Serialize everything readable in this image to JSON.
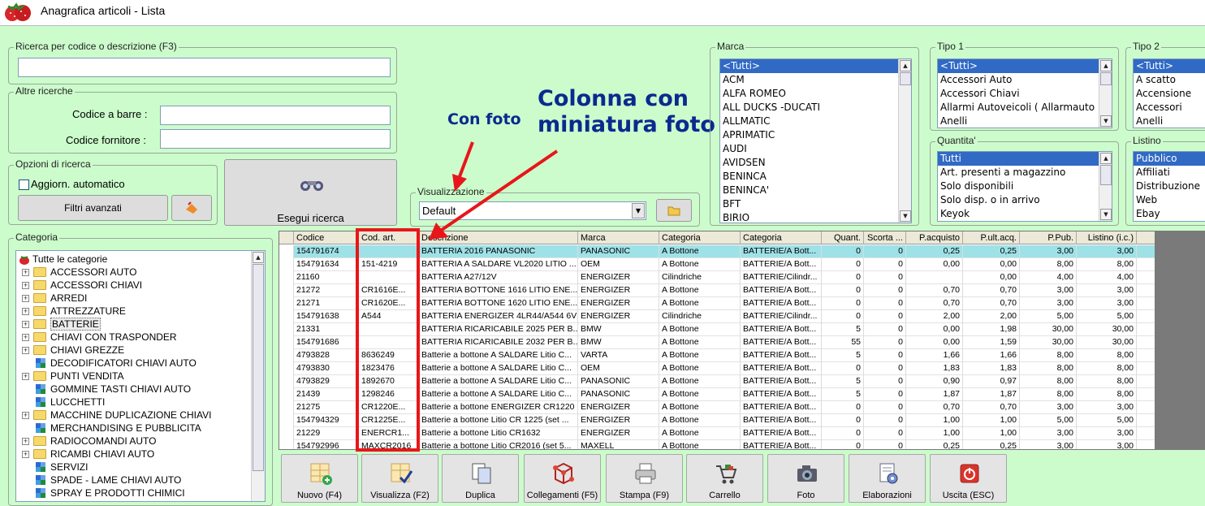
{
  "window": {
    "title": "Anagrafica articoli  - Lista"
  },
  "search": {
    "main_group": "Ricerca per codice o descrizione (F3)",
    "main_value": "",
    "other_group": "Altre ricerche",
    "barcode_label": "Codice a barre :",
    "supplier_label": "Codice fornitore :",
    "options_group": "Opzioni di ricerca",
    "auto_update_label": "Aggiorn. automatico",
    "advanced_filters": "Filtri avanzati",
    "run_search": "Esegui ricerca"
  },
  "view": {
    "group": "Visualizzazione",
    "selected": "Default"
  },
  "annotations": {
    "con_foto": "Con foto",
    "colonna_line1": "Colonna con",
    "colonna_line2": "miniatura foto",
    "color": "#e8161a",
    "text_color": "#0a2a8f"
  },
  "filters": {
    "marca": {
      "label": "Marca",
      "items": [
        "<Tutti>",
        "ACM",
        "ALFA ROMEO",
        "ALL DUCKS -DUCATI",
        "ALLMATIC",
        "APRIMATIC",
        "AUDI",
        "AVIDSEN",
        "BENINCA",
        "BENINCA'",
        "BFT",
        "BIRIO"
      ]
    },
    "tipo1": {
      "label": "Tipo 1",
      "items": [
        "<Tutti>",
        "Accessori Auto",
        "Accessori Chiavi",
        "Allarmi Autoveicoli ( Allarmauto )",
        "Anelli"
      ]
    },
    "tipo2": {
      "label": "Tipo 2",
      "items": [
        "<Tutti>",
        "A scatto",
        "Accensione",
        "Accessori",
        "Anelli"
      ]
    },
    "quantita": {
      "label": "Quantita'",
      "items": [
        "Tutti",
        "Art. presenti a magazzino",
        "Solo disponibili",
        "Solo disp. o in arrivo",
        "Keyok"
      ]
    },
    "listino": {
      "label": "Listino",
      "items": [
        "Pubblico",
        "Affiliati",
        "Distribuzione",
        "Web",
        "Ebay"
      ]
    }
  },
  "categories": {
    "label": "Categoria",
    "root": "Tutte le categorie",
    "items": [
      {
        "name": "ACCESSORI AUTO",
        "type": "folder"
      },
      {
        "name": "ACCESSORI CHIAVI",
        "type": "folder"
      },
      {
        "name": "ARREDI",
        "type": "folder"
      },
      {
        "name": "ATTREZZATURE",
        "type": "folder"
      },
      {
        "name": "BATTERIE",
        "type": "folder"
      },
      {
        "name": "CHIAVI CON TRASPONDER",
        "type": "folder"
      },
      {
        "name": "CHIAVI GREZZE",
        "type": "folder"
      },
      {
        "name": "DECODIFICATORI CHIAVI AUTO",
        "type": "leaf"
      },
      {
        "name": "PUNTI VENDITA",
        "type": "folder"
      },
      {
        "name": "GOMMINE TASTI CHIAVI AUTO",
        "type": "leaf"
      },
      {
        "name": "LUCCHETTI",
        "type": "leaf"
      },
      {
        "name": "MACCHINE DUPLICAZIONE CHIAVI",
        "type": "folder"
      },
      {
        "name": "MERCHANDISING E PUBBLICITA",
        "type": "leaf"
      },
      {
        "name": "RADIOCOMANDI AUTO",
        "type": "folder"
      },
      {
        "name": "RICAMBI CHIAVI AUTO",
        "type": "folder"
      },
      {
        "name": "SERVIZI",
        "type": "leaf"
      },
      {
        "name": "SPADE - LAME CHIAVI AUTO",
        "type": "leaf"
      },
      {
        "name": "SPRAY E PRODOTTI CHIMICI",
        "type": "leaf"
      }
    ]
  },
  "table": {
    "columns": [
      "Codice",
      "Cod. art.",
      "Descrizione",
      "Marca",
      "Categoria",
      "Categoria",
      "Quant.",
      "Scorta ...",
      "P.acquisto",
      "P.ult.acq.",
      "P.Pub.",
      "Listino (i.c.)"
    ],
    "rows": [
      [
        "154791674",
        "",
        "BATTERIA 2016 PANASONIC",
        "PANASONIC",
        "A Bottone",
        "BATTERIE/A Bott...",
        "0",
        "0",
        "0,25",
        "0,25",
        "3,00",
        "3,00"
      ],
      [
        "154791634",
        "151-4219",
        "BATTERIA A SALDARE VL2020 LITIO ...",
        "OEM",
        "A Bottone",
        "BATTERIE/A Bott...",
        "0",
        "0",
        "0,00",
        "0,00",
        "8,00",
        "8,00"
      ],
      [
        "21160",
        "",
        "BATTERIA A27/12V",
        "ENERGIZER",
        "Cilindriche",
        "BATTERIE/Cilindr...",
        "0",
        "0",
        "",
        "0,00",
        "4,00",
        "4,00"
      ],
      [
        "21272",
        "CR1616E...",
        "BATTERIA BOTTONE 1616 LITIO ENE...",
        "ENERGIZER",
        "A Bottone",
        "BATTERIE/A Bott...",
        "0",
        "0",
        "0,70",
        "0,70",
        "3,00",
        "3,00"
      ],
      [
        "21271",
        "CR1620E...",
        "BATTERIA BOTTONE 1620 LITIO ENE...",
        "ENERGIZER",
        "A Bottone",
        "BATTERIE/A Bott...",
        "0",
        "0",
        "0,70",
        "0,70",
        "3,00",
        "3,00"
      ],
      [
        "154791638",
        "A544",
        "BATTERIA ENERGIZER 4LR44/A544 6V",
        "ENERGIZER",
        "Cilindriche",
        "BATTERIE/Cilindr...",
        "0",
        "0",
        "2,00",
        "2,00",
        "5,00",
        "5,00"
      ],
      [
        "21331",
        "",
        "BATTERIA RICARICABILE 2025 PER B...",
        "BMW",
        "A Bottone",
        "BATTERIE/A Bott...",
        "5",
        "0",
        "0,00",
        "1,98",
        "30,00",
        "30,00"
      ],
      [
        "154791686",
        "",
        "BATTERIA RICARICABILE 2032 PER B...",
        "BMW",
        "A Bottone",
        "BATTERIE/A Bott...",
        "55",
        "0",
        "0,00",
        "1,59",
        "30,00",
        "30,00"
      ],
      [
        "4793828",
        "8636249",
        "Batterie a bottone  A SALDARE Litio C...",
        "VARTA",
        "A Bottone",
        "BATTERIE/A Bott...",
        "5",
        "0",
        "1,66",
        "1,66",
        "8,00",
        "8,00"
      ],
      [
        "4793830",
        "1823476",
        "Batterie a bottone  A SALDARE Litio C...",
        "OEM",
        "A Bottone",
        "BATTERIE/A Bott...",
        "0",
        "0",
        "1,83",
        "1,83",
        "8,00",
        "8,00"
      ],
      [
        "4793829",
        "1892670",
        "Batterie a bottone  A SALDARE Litio C...",
        "PANASONIC",
        "A Bottone",
        "BATTERIE/A Bott...",
        "5",
        "0",
        "0,90",
        "0,97",
        "8,00",
        "8,00"
      ],
      [
        "21439",
        "1298246",
        "Batterie a bottone  A SALDARE Litio C...",
        "PANASONIC",
        "A Bottone",
        "BATTERIE/A Bott...",
        "5",
        "0",
        "1,87",
        "1,87",
        "8,00",
        "8,00"
      ],
      [
        "21275",
        "CR1220E...",
        "Batterie a bottone ENERGIZER CR1220",
        "ENERGIZER",
        "A Bottone",
        "BATTERIE/A Bott...",
        "0",
        "0",
        "0,70",
        "0,70",
        "3,00",
        "3,00"
      ],
      [
        "154794329",
        "CR1225E...",
        "Batterie a bottone Litio CR 1225 (set ...",
        "ENERGIZER",
        "A Bottone",
        "BATTERIE/A Bott...",
        "0",
        "0",
        "1,00",
        "1,00",
        "5,00",
        "5,00"
      ],
      [
        "21229",
        "ENERCR1...",
        "Batterie a bottone Litio CR1632",
        "ENERGIZER",
        "A Bottone",
        "BATTERIE/A Bott...",
        "0",
        "0",
        "1,00",
        "1,00",
        "3,00",
        "3,00"
      ],
      [
        "154792996",
        "MAXCR2016",
        "Batterie a bottone Litio CR2016 (set 5...",
        "MAXELL",
        "A Bottone",
        "BATTERIE/A Bott...",
        "0",
        "0",
        "0,25",
        "0,25",
        "3,00",
        "3,00"
      ]
    ]
  },
  "toolbar": [
    {
      "label": "Nuovo (F4)",
      "icon": "new-grid-icon"
    },
    {
      "label": "Visualizza (F2)",
      "icon": "view-check-icon"
    },
    {
      "label": "Duplica",
      "icon": "duplicate-icon"
    },
    {
      "label": "Collegamenti (F5)",
      "icon": "links-icon"
    },
    {
      "label": "Stampa (F9)",
      "icon": "printer-icon"
    },
    {
      "label": "Carrello",
      "icon": "cart-icon"
    },
    {
      "label": "Foto",
      "icon": "camera-icon"
    },
    {
      "label": "Elaborazioni",
      "icon": "processing-icon"
    },
    {
      "label": "Uscita (ESC)",
      "icon": "exit-icon"
    }
  ]
}
